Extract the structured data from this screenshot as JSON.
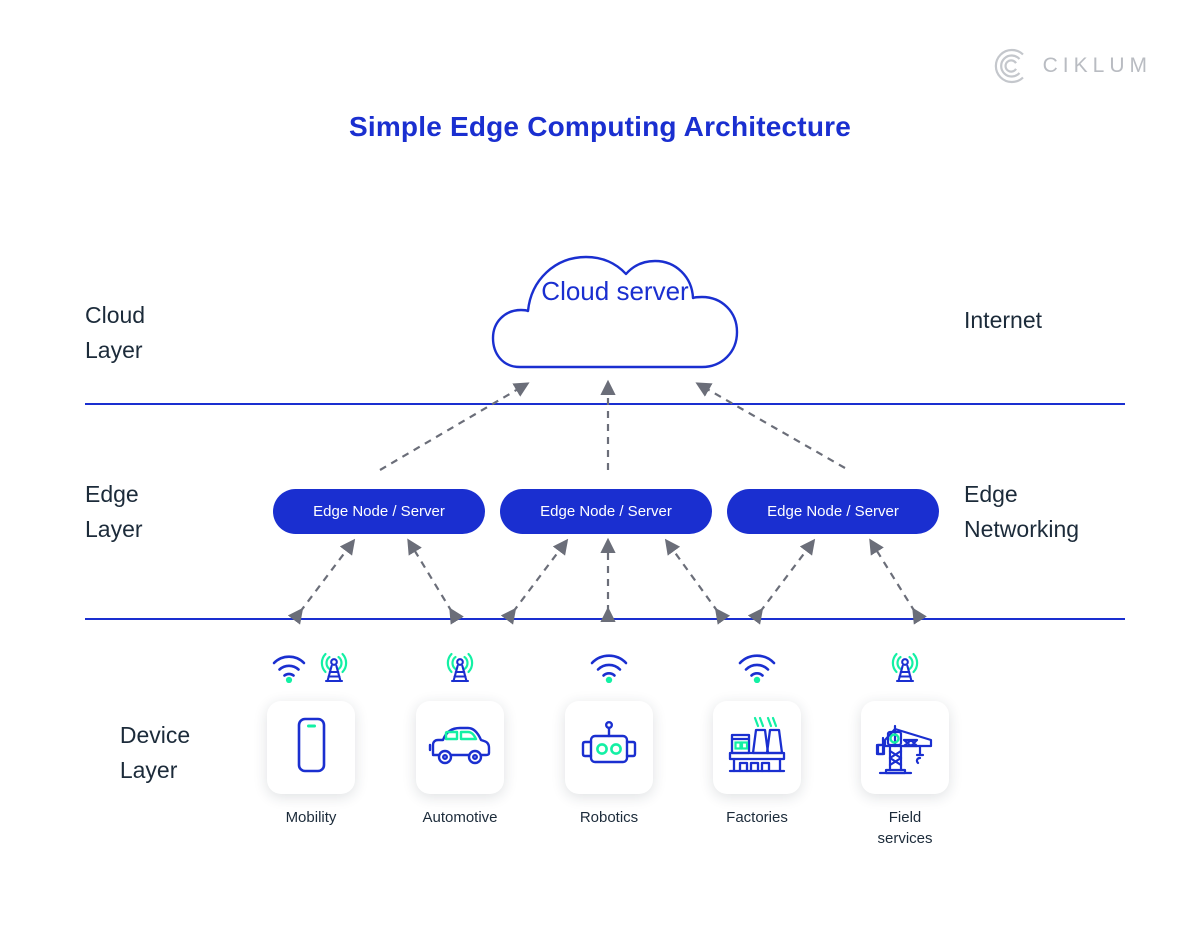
{
  "brand": {
    "name": "CIKLUM",
    "mark_icon": "ciklum-c-icon"
  },
  "title": "Simple Edge Computing Architecture",
  "colors": {
    "primary_blue": "#1a2fd0",
    "dark_navy": "#1c2b3a",
    "accent_green": "#13f0a4",
    "arrow_gray": "#6b6e79",
    "logo_gray": "#b9bcc2"
  },
  "layers": {
    "cloud": {
      "label": "Cloud\nLayer",
      "side_label": "Internet"
    },
    "edge": {
      "label": "Edge\nLayer",
      "side_label": "Edge\nNetworking"
    },
    "device": {
      "label": "Device\nLayer"
    }
  },
  "cloud_node": {
    "label": "Cloud\nserver",
    "icon": "cloud-icon"
  },
  "edge_nodes": [
    {
      "label": "Edge Node / Server"
    },
    {
      "label": "Edge Node / Server"
    },
    {
      "label": "Edge Node / Server"
    }
  ],
  "devices": [
    {
      "label": "Mobility",
      "icon": "smartphone-icon",
      "signals": [
        "wifi-icon",
        "antenna-tower-icon"
      ]
    },
    {
      "label": "Automotive",
      "icon": "car-icon",
      "signals": [
        "antenna-tower-icon"
      ]
    },
    {
      "label": "Robotics",
      "icon": "robot-icon",
      "signals": [
        "wifi-icon"
      ]
    },
    {
      "label": "Factories",
      "icon": "factory-icon",
      "signals": [
        "wifi-icon"
      ]
    },
    {
      "label": "Field\nservices",
      "icon": "crane-icon",
      "signals": [
        "antenna-tower-icon"
      ]
    }
  ],
  "connections": {
    "cloud_to_edge_style": "dashed-single-arrow-up",
    "edge_to_device_style": "dashed-double-arrow"
  }
}
